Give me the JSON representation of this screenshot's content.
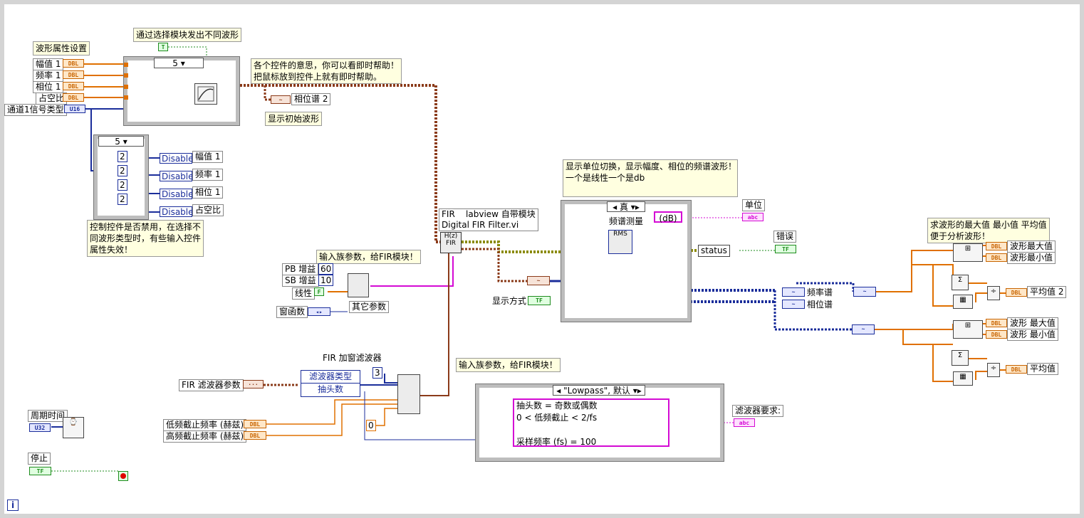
{
  "notes": {
    "select_module": "通过选择模块发出不同波形",
    "wave_props": "波形属性设置",
    "controls_help": "各个控件的意思，你可以看即时帮助！\n把鼠标放到控件上就有即时帮助。",
    "show_initial": "显示初始波形",
    "disable_help": "控制控件是否禁用，在选择不\n同波形类型时，有些输入控件\n属性失效！",
    "fir_module": "FIR    labview 自带模块\nDigital FIR Filter.vi",
    "input_params": "输入族参数，给FIR模块！",
    "input_params2": "输入族参数，给FIR模块！",
    "spectrum_help": "显示单位切换，显示幅度、相位的频谱波形！\n一个是线性一个是db",
    "stats_help": "求波形的最大值 最小值 平均值\n便于分析波形！",
    "fir_window": "FIR 加窗滤波器",
    "filter_req": "滤波器要求:",
    "period": "周期时间",
    "stop": "停止"
  },
  "controls": {
    "amp": "幅值 1",
    "freq": "频率 1",
    "phase": "相位 1",
    "duty": "占空比",
    "ch1_type": "通道1信号类型",
    "phase_spec2": "相位谱 2",
    "dis_amp": "幅值 1",
    "dis_freq": "频率 1",
    "dis_phase": "相位 1",
    "dis_duty": "占空比",
    "pb_gain": "PB 增益",
    "sb_gain": "SB 增益",
    "linear": "线性",
    "window": "窗函数",
    "other_params": "其它参数",
    "display_mode": "显示方式",
    "unit": "单位",
    "error": "错误",
    "status": "status",
    "spectrum_mag": "频率谱",
    "spectrum_phase": "相位谱",
    "wave_max": "波形最大值",
    "wave_min": "波形最小值",
    "avg2": "平均值 2",
    "wave_max2": "波形 最大值",
    "wave_min2": "波形 最小值",
    "avg": "平均值",
    "fir_filter_params": "FIR 滤波器参数",
    "low_cutoff": "低频截止频率 (赫兹)",
    "high_cutoff": "高频截止频率 (赫兹)",
    "filter_type": "滤波器类型",
    "taps": "抽头数",
    "spectrum_measure": "频谱测量"
  },
  "values": {
    "case5a": "5",
    "case5b": "5",
    "true_case": "真",
    "lowpass_case": "\"Lowpass\", 默认",
    "db": "(dB)",
    "pb_val": "60",
    "sb_val": "10",
    "three": "3",
    "zero": "0",
    "two": "2",
    "disabled": "Disabled",
    "f_const": "F",
    "t_const": "T",
    "rms": "RMS"
  },
  "terminals": {
    "dbl": "DBL",
    "u16": "U16",
    "u32": "U32",
    "tf": "TF",
    "abc": "abc"
  },
  "filter_text": "抽头数 = 奇数或偶数\n0 < 低频截止 < 2/fs\n\n采样频率 (fs) = 100",
  "colors": {
    "orange_wire": "#e07000",
    "blue_wire": "#1b2e9b",
    "pink_wire": "#d40ad4",
    "green_wire": "#1e8c1e",
    "brown_wire": "#8b3b1a"
  }
}
